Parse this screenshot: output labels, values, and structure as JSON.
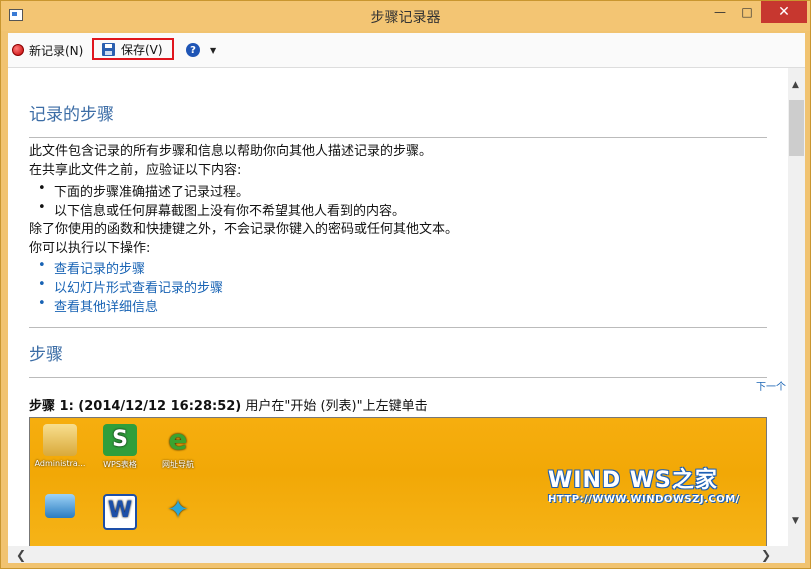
{
  "window": {
    "title": "步骤记录器"
  },
  "toolbar": {
    "new_record": "新记录(N)",
    "save": "保存(V)",
    "help": "?"
  },
  "content": {
    "section1_title": "记录的步骤",
    "intro": "此文件包含记录的所有步骤和信息以帮助你向其他人描述记录的步骤。",
    "verify": "在共享此文件之前，应验证以下内容:",
    "bullets": [
      "下面的步骤准确描述了记录过程。",
      "以下信息或任何屏幕截图上没有你不希望其他人看到的内容。"
    ],
    "exclude": "除了你使用的函数和快捷键之外，不会记录你键入的密码或任何其他文本。",
    "can_do": "你可以执行以下操作:",
    "links": [
      "查看记录的步骤",
      "以幻灯片形式查看记录的步骤",
      "查看其他详细信息"
    ],
    "section2_title": "步骤",
    "next_link": "下一个",
    "step1": {
      "label": "步骤  1: (2014/12/12 16:28:52)",
      "desc": " 用户在\"开始 (列表)\"上左键单击"
    }
  },
  "screenshot": {
    "icons": [
      "Administra...",
      "WPS表格",
      "网址导航",
      "",
      "",
      ""
    ],
    "logo": "WIND  WS之家",
    "url": "HTTP://WWW.WINDOWSZJ.COM/"
  }
}
